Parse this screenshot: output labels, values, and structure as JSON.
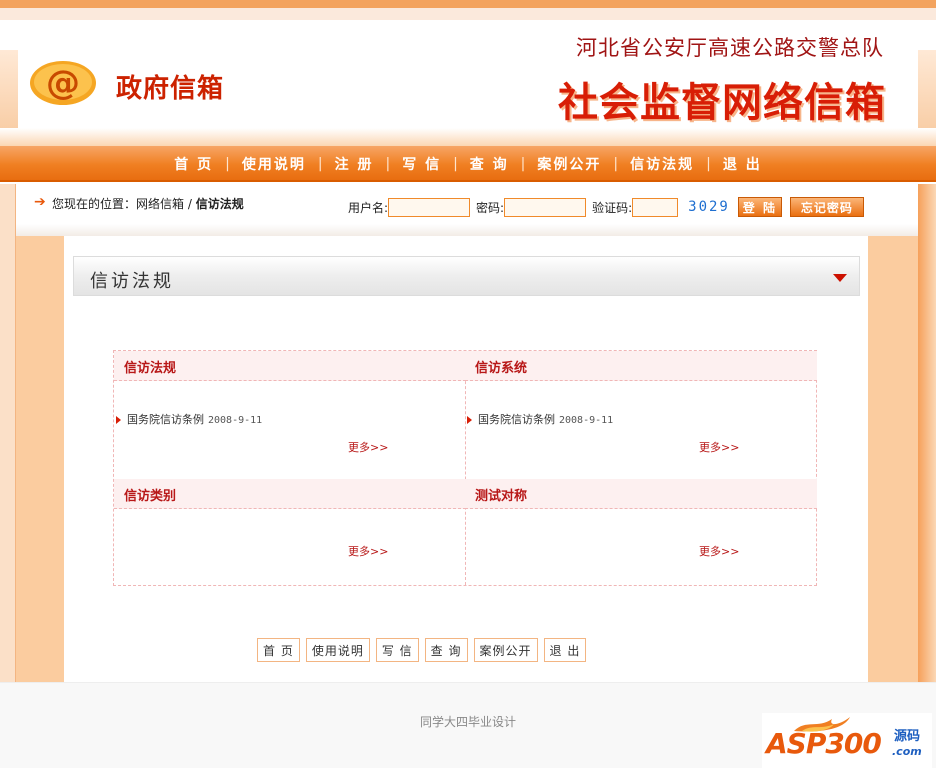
{
  "header": {
    "logo_text": "政府信箱",
    "agency": "河北省公安厅高速公路交警总队",
    "title": "社会监督网络信箱"
  },
  "nav": {
    "items": [
      "首 页",
      "使用说明",
      "注 册",
      "写 信",
      "查 询",
      "案例公开",
      "信访法规",
      "退 出"
    ],
    "separator": "|"
  },
  "location": {
    "label": "您现在的位置：",
    "path": "网络信箱",
    "divider": " / ",
    "current": "信访法规"
  },
  "login": {
    "username_label": "用户名:",
    "username_value": "",
    "password_label": "密码:",
    "password_value": "",
    "captcha_label": "验证码:",
    "captcha_value": "",
    "captcha_code": "3029",
    "login_button": "登 陆",
    "forgot_button": "忘记密码"
  },
  "section": {
    "title": "信访法规"
  },
  "categories": [
    {
      "title": "信访法规",
      "items": [
        {
          "text": "国务院信访条例",
          "date": "2008-9-11"
        }
      ],
      "more": "更多>>"
    },
    {
      "title": "信访系统",
      "items": [
        {
          "text": "国务院信访条例",
          "date": "2008-9-11"
        }
      ],
      "more": "更多>>"
    },
    {
      "title": "信访类别",
      "items": [],
      "more": "更多>>"
    },
    {
      "title": "测试对称",
      "items": [],
      "more": "更多>>"
    }
  ],
  "footer_nav": [
    "首 页",
    "使用说明",
    "写 信",
    "查 询",
    "案例公开",
    "退 出"
  ],
  "footer": {
    "credit": "同学大四毕业设计"
  },
  "watermark": {
    "brand": "ASP300",
    "side": "源码",
    "domain": ".com"
  },
  "colors": {
    "accent": "#f07f22",
    "title_red": "#d81e06",
    "heading_red": "#b81818",
    "side_orange": "#fbcc9f"
  }
}
